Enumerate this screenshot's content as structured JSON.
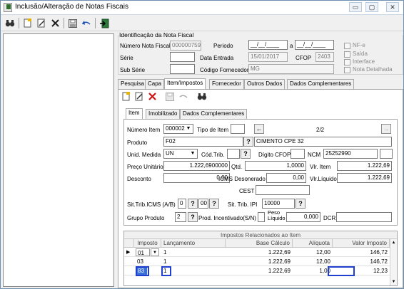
{
  "window": {
    "title": "Inclusão/Alteração de Notas Fiscais",
    "minimize_label": "▭",
    "maximize_label": "▢",
    "close_label": "✕"
  },
  "identificacao": {
    "group_label": "Identificação da Nota Fiscal",
    "numero_label": "Número Nota Fiscal",
    "numero_value": "000000759",
    "periodo_label": "Periodo",
    "periodo_from": "__/__/____",
    "periodo_a_label": "a",
    "periodo_to": "__/__/____",
    "serie_label": "Série",
    "serie_value": "",
    "data_entrada_label": "Data Entrada",
    "data_entrada_value": "15/01/2017",
    "cfop_label": "CFOP",
    "cfop_value": "2403",
    "subserie_label": "Sub Série",
    "subserie_value": "",
    "cod_fornecedor_label": "Código Fornecedor",
    "cod_fornecedor_value": "MG",
    "checks": [
      "NF-e",
      "Saída",
      "Interface",
      "Nota Detalhada"
    ]
  },
  "main_tabs": [
    "Pesquisa",
    "Capa",
    "Item/Impostos",
    "Fornecedor",
    "Outros Dados",
    "Dados Complementares"
  ],
  "sub_tabs": [
    "Item",
    "Imobilizado",
    "Dados Complementares"
  ],
  "item": {
    "numero_item_label": "Número Item",
    "numero_item_value": "000002",
    "tipo_item_label": "Tipo de Item",
    "tipo_item_value": "",
    "paginacao": "2/2",
    "produto_label": "Produto",
    "produto_code": "F02",
    "produto_desc": "CIMENTO CPE 32",
    "unid_medida_label": "Unid. Medida",
    "unid_medida_value": "UN",
    "cod_trib_label": "Cód.Trib.",
    "cod_trib_value": "",
    "digito_cfop_label": "Dígito CFOP",
    "digito_cfop_value": "",
    "ncm_label": "NCM",
    "ncm_value": "25252990",
    "preco_unitario_label": "Preço Unitário",
    "preco_unitario_value": "1.222,6900000",
    "qtd_label": "Qtd.",
    "qtd_value": "1,0000",
    "vlr_item_label": "Vlr. Item",
    "vlr_item_value": "1.222,69",
    "desconto_label": "Desconto",
    "desconto_value": "0,00",
    "icms_deson_label": "ICMS Desonerado",
    "icms_deson_value": "0,00",
    "vlr_liquido_label": "Vlr.Líquido",
    "vlr_liquido_value": "1.222,69",
    "cest_label": "CEST",
    "cest_value": "",
    "sit_trib_icms_label": "Sit.Trib.ICMS (A/B)",
    "sit_trib_icms_a": "0",
    "sit_trib_icms_b": "00",
    "sit_trib_ipi_label": "Sit. Trib. IPI",
    "sit_trib_ipi_value": "10000",
    "grupo_produto_label": "Grupo Produto",
    "grupo_produto_value": "2",
    "prod_incentivado_label": "Prod. Incentivado(S/N)",
    "peso_liquido_label": "Peso\nLíquido",
    "peso_liquido_value": "0,000",
    "dcr_label": "DCR",
    "dcr_value": ""
  },
  "impostos_grid": {
    "title": "Impostos Relacionados ao Item",
    "headers": [
      "Imposto",
      "Lançamento",
      "Base Cálculo",
      "Alíquota",
      "Valor Imposto"
    ],
    "rows": [
      {
        "imposto": "01",
        "lancamento": "1",
        "base": "1.222,69",
        "aliquota": "12,00",
        "valor": "146,72"
      },
      {
        "imposto": "03",
        "lancamento": "1",
        "base": "1.222,69",
        "aliquota": "12,00",
        "valor": "146,72"
      },
      {
        "imposto": "83",
        "lancamento": "1",
        "base": "1.222,69",
        "aliquota": "1,00",
        "valor": "12,23"
      }
    ]
  },
  "colors": {
    "highlight": "#1f3fd0",
    "selected_row": "#3a6fd8"
  }
}
